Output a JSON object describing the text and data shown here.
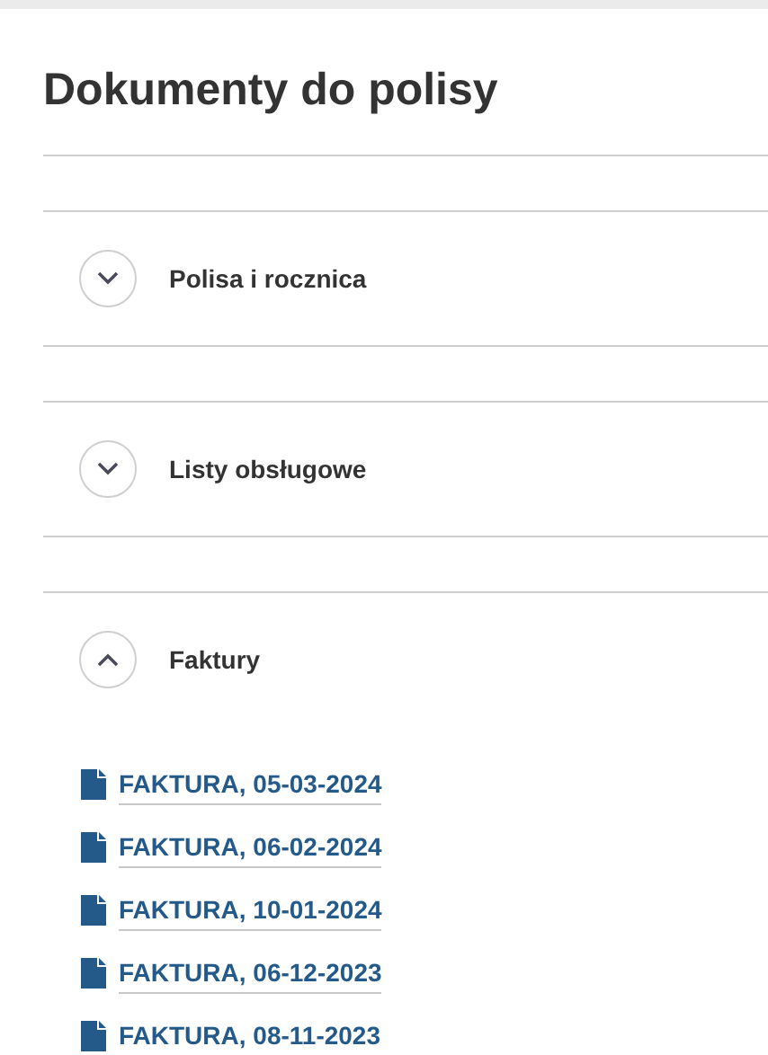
{
  "title": "Dokumenty do polisy",
  "sections": [
    {
      "label": "Polisa i rocznica",
      "expanded": false
    },
    {
      "label": "Listy obsługowe",
      "expanded": false
    },
    {
      "label": "Faktury",
      "expanded": true,
      "documents": [
        "FAKTURA, 05-03-2024",
        "FAKTURA, 06-02-2024",
        "FAKTURA, 10-01-2024",
        "FAKTURA, 06-12-2023",
        "FAKTURA, 08-11-2023"
      ]
    }
  ]
}
